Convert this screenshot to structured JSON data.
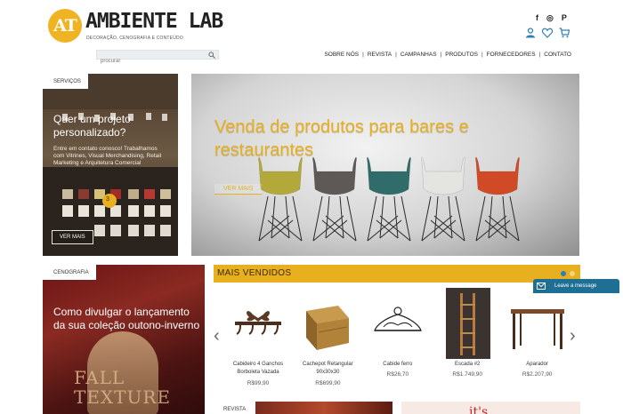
{
  "header": {
    "logo_mark": "AT",
    "logo_name": "AMBIENTE LAB",
    "logo_tagline": "DECORAÇÃO, CENOGRAFIA E CONTEÚDO",
    "social": [
      "facebook-icon",
      "instagram-icon",
      "pinterest-icon"
    ],
    "social_glyphs": [
      "f",
      "◎",
      "P"
    ],
    "search_placeholder": "procurar",
    "nav": [
      "SOBRE NÓS",
      "REVISTA",
      "CAMPANHAS",
      "PRODUTOS",
      "FORNECEDORES",
      "CONTATO"
    ]
  },
  "services": {
    "tag": "SERVIÇOS",
    "title": "Quer um projeto personalizado?",
    "text": "Entre em contato conosco! Trabalhamos com Vitrines, Visual Merchandising, Retail Marketing e Arquitetura Comercial",
    "button": "VER MAIS",
    "slide_number": "3"
  },
  "hero": {
    "title": "Venda de produtos para bares e restaurantes",
    "button": "VER MAIS",
    "chair_colors": [
      "#b3a93a",
      "#5e5956",
      "#2f6c6a",
      "#e4e4e1",
      "#cf4a25"
    ]
  },
  "scenography": {
    "tag": "CENOGRAFIA",
    "title": "Como divulgar o lançamento da sua coleção outono-inverno",
    "bg_text": "FALL TEXTURE"
  },
  "best_sellers": {
    "title": "MAIS VENDIDOS",
    "products": [
      {
        "name": "Cabideiro 4 Ganchos Borboleta Vazada",
        "price": "R$99,90"
      },
      {
        "name": "Cachepot Retangular 90x30x30",
        "price": "R$699,90"
      },
      {
        "name": "Cabide ferro",
        "price": "R$26,70"
      },
      {
        "name": "Escada #2",
        "price": "R$1.749,90"
      },
      {
        "name": "Aparador",
        "price": "R$2.207,90"
      }
    ]
  },
  "blog": {
    "tag": "REVISTA",
    "snippet": "it's"
  },
  "chat": {
    "label": "Leave a message"
  }
}
